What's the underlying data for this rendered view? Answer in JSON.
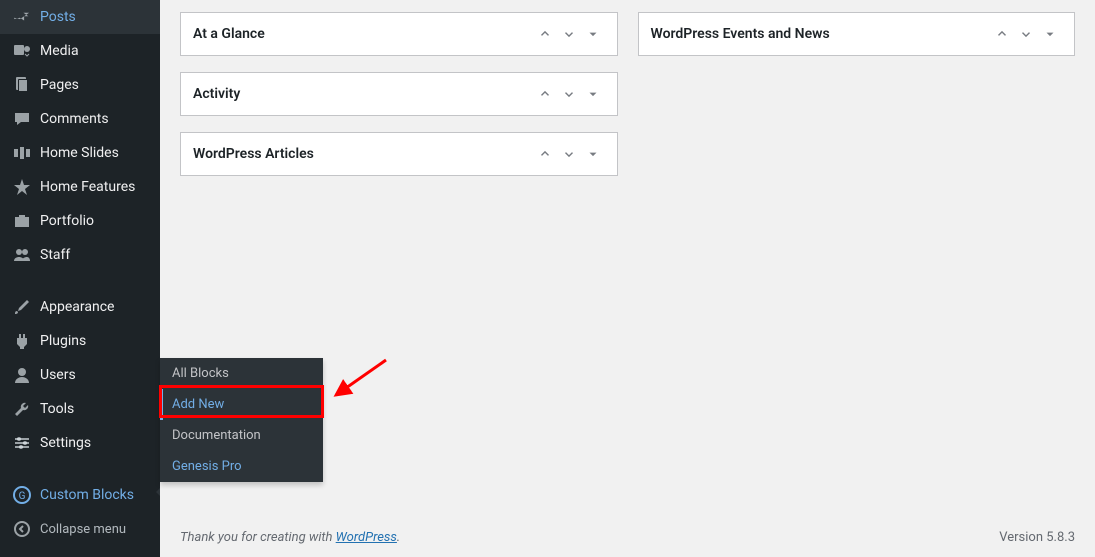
{
  "sidebar": {
    "items": [
      {
        "label": "Posts",
        "icon": "pin"
      },
      {
        "label": "Media",
        "icon": "media"
      },
      {
        "label": "Pages",
        "icon": "pages"
      },
      {
        "label": "Comments",
        "icon": "comments"
      },
      {
        "label": "Home Slides",
        "icon": "frames"
      },
      {
        "label": "Home Features",
        "icon": "star"
      },
      {
        "label": "Portfolio",
        "icon": "portfolio"
      },
      {
        "label": "Staff",
        "icon": "users"
      },
      {
        "label": "Appearance",
        "icon": "brush"
      },
      {
        "label": "Plugins",
        "icon": "plug"
      },
      {
        "label": "Users",
        "icon": "user"
      },
      {
        "label": "Tools",
        "icon": "wrench"
      },
      {
        "label": "Settings",
        "icon": "sliders"
      },
      {
        "label": "Custom Blocks",
        "icon": "genesis",
        "active": true
      }
    ],
    "collapse": "Collapse menu"
  },
  "submenu": {
    "items": [
      {
        "label": "All Blocks"
      },
      {
        "label": "Add New",
        "highlighted": true
      },
      {
        "label": "Documentation"
      },
      {
        "label": "Genesis Pro",
        "class": "genesis"
      }
    ]
  },
  "dashboard": {
    "col1": [
      {
        "title": "At a Glance"
      },
      {
        "title": "Activity"
      },
      {
        "title": "WordPress Articles"
      }
    ],
    "col2": [
      {
        "title": "WordPress Events and News"
      }
    ]
  },
  "footer": {
    "thank_prefix": "Thank you for creating with ",
    "wordpress": "WordPress",
    "thank_suffix": ".",
    "version": "Version 5.8.3"
  }
}
